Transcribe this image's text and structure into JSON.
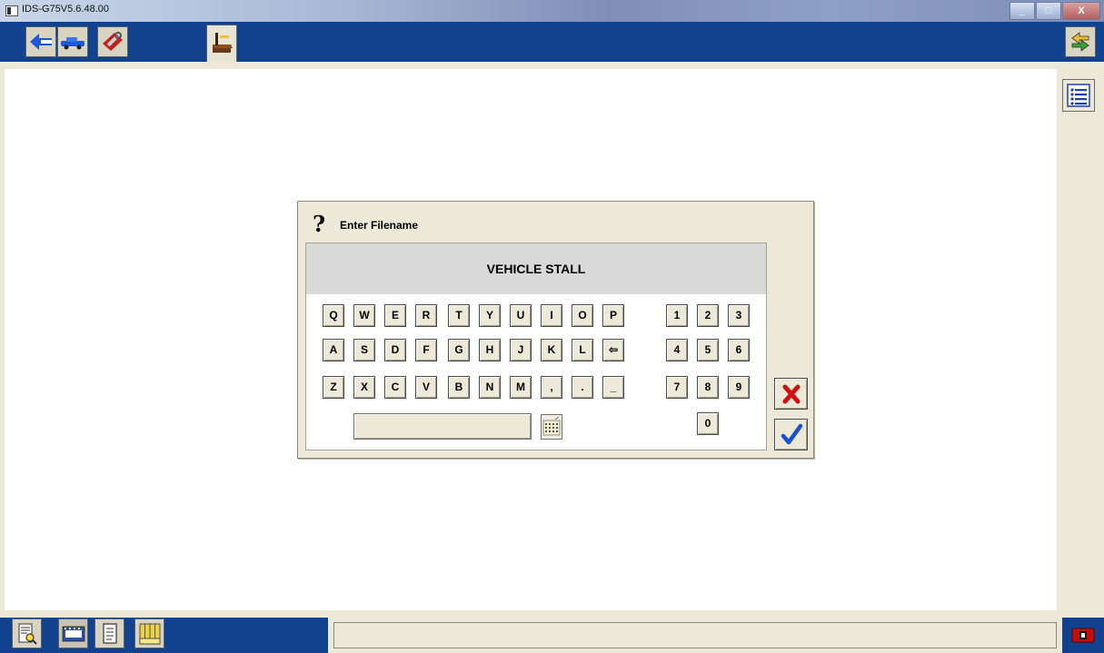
{
  "window": {
    "title": "IDS-G75V5.6.48.00",
    "controls": [
      "_",
      "□",
      "X"
    ]
  },
  "toolbar": {
    "left_tools": [
      {
        "name": "back-arrow-icon"
      },
      {
        "name": "vehicle-icon"
      },
      {
        "name": "toolbox-icon"
      }
    ],
    "active_tab": {
      "name": "workstation-icon"
    },
    "right_tool": {
      "name": "swap-arrows-icon"
    }
  },
  "dialog": {
    "prompt_glyph": "?",
    "title": "Enter Filename",
    "value": "VEHICLE STALL",
    "keyboard": {
      "rows": [
        [
          "Q",
          "W",
          "E",
          "R",
          "T",
          "Y",
          "U",
          "I",
          "O",
          "P"
        ],
        [
          "A",
          "S",
          "D",
          "F",
          "G",
          "H",
          "J",
          "K",
          "L",
          "⇦"
        ],
        [
          "Z",
          "X",
          "C",
          "V",
          "B",
          "N",
          "M",
          ",",
          ".",
          "_"
        ]
      ],
      "numpad": [
        [
          "1",
          "2",
          "3"
        ],
        [
          "4",
          "5",
          "6"
        ],
        [
          "7",
          "8",
          "9"
        ]
      ],
      "zero": "0"
    },
    "cancel_icon": "cross-icon",
    "ok_icon": "checkmark-icon"
  },
  "bottom": {
    "tools": [
      "search-document-icon",
      "film-strip-icon",
      "document-icon",
      "abcd-columns-icon"
    ],
    "status_text": "",
    "exit_icon": "exit-icon"
  },
  "colors": {
    "toolbar_blue": "#12428e",
    "panel_beige": "#ece9d8",
    "cancel_red": "#cc1111",
    "ok_blue": "#1a4fd0"
  }
}
